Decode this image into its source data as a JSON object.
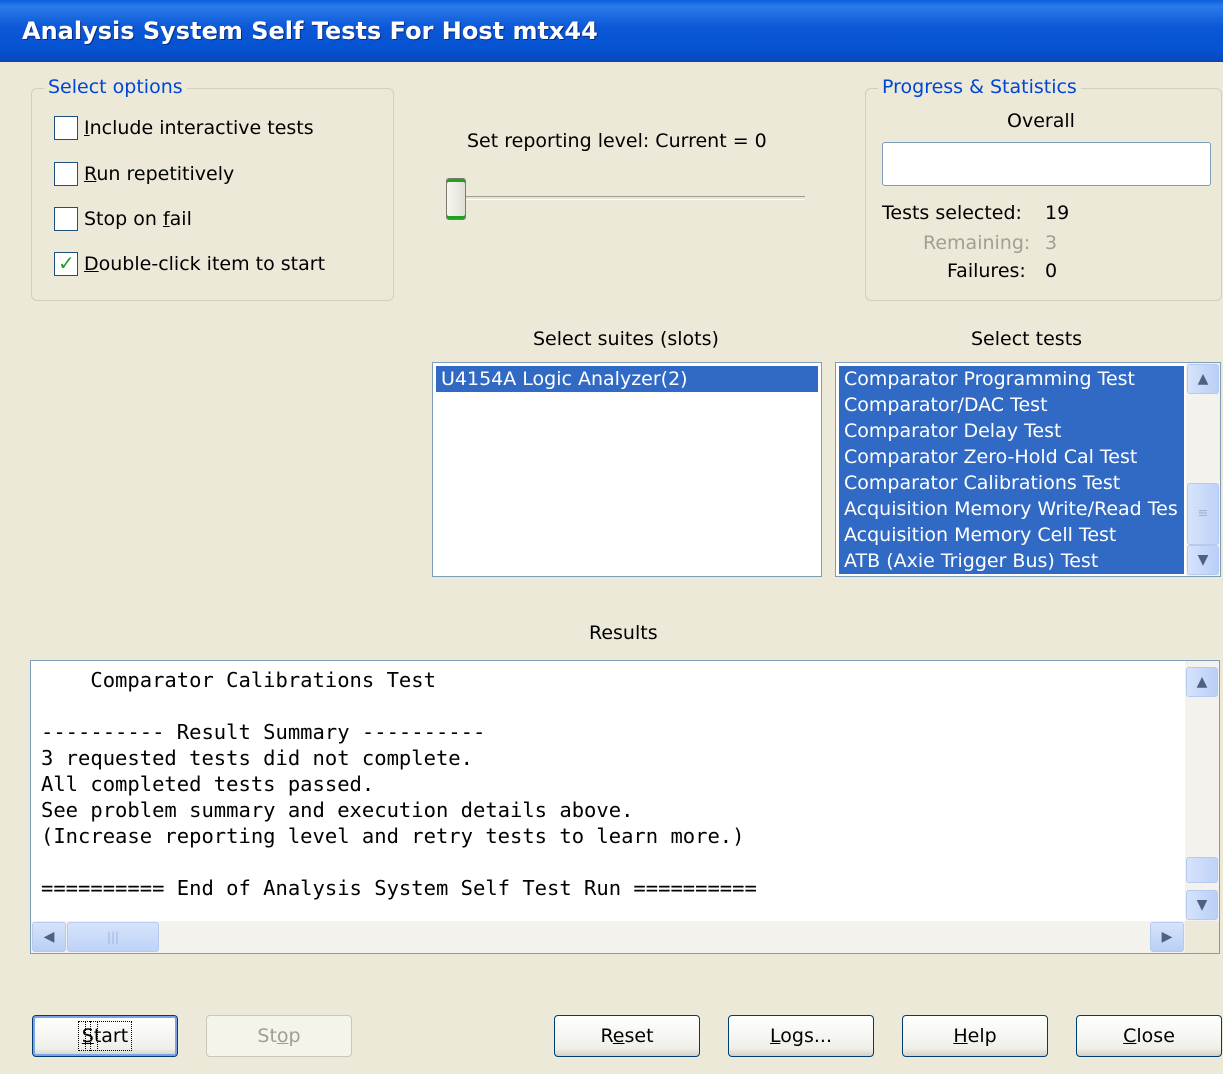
{
  "window": {
    "title": "Analysis System Self Tests For Host mtx44"
  },
  "options": {
    "legend": "Select options",
    "checkboxes": [
      {
        "label": "Include interactive tests",
        "mnemonic_prefix": "",
        "mnemonic": "I",
        "rest": "nclude interactive tests",
        "checked": false
      },
      {
        "label": "Run repetitively",
        "mnemonic_prefix": "",
        "mnemonic": "R",
        "rest": "un repetitively",
        "checked": false
      },
      {
        "label": "Stop on fail",
        "mnemonic_prefix": "Stop on ",
        "mnemonic": "f",
        "rest": "ail",
        "checked": false
      },
      {
        "label": "Double-click item to start",
        "mnemonic_prefix": "",
        "mnemonic": "D",
        "rest": "ouble-click item to start",
        "checked": true
      }
    ]
  },
  "reporting": {
    "label": "Set reporting level: Current = 0",
    "level": 0
  },
  "progress": {
    "legend": "Progress & Statistics",
    "overall_label": "Overall",
    "overall_value": 0,
    "tests_selected_label": "Tests selected:",
    "tests_selected": "19",
    "remaining_label": "Remaining:",
    "remaining": "3",
    "failures_label": "Failures:",
    "failures": "0"
  },
  "suites": {
    "label": "Select suites (slots)",
    "items": [
      "U4154A Logic Analyzer(2)"
    ]
  },
  "tests": {
    "label": "Select tests",
    "items": [
      "Comparator Programming Test",
      "Comparator/DAC Test",
      "Comparator Delay Test",
      "Comparator Zero-Hold Cal Test",
      "Comparator Calibrations Test",
      "Acquisition Memory Write/Read Tes",
      "Acquisition Memory Cell Test",
      "ATB (Axie Trigger Bus) Test"
    ]
  },
  "results": {
    "label": "Results",
    "text": "    Comparator Calibrations Test\n\n---------- Result Summary ----------\n3 requested tests did not complete.\nAll completed tests passed.\nSee problem summary and execution details above.\n(Increase reporting level and retry tests to learn more.)\n\n========== End of Analysis System Self Test Run =========="
  },
  "buttons": {
    "start": {
      "pre": "",
      "mn": "S",
      "post": "tart"
    },
    "stop": {
      "pre": "St",
      "mn": "o",
      "post": "p"
    },
    "reset": {
      "pre": "R",
      "mn": "e",
      "post": "set"
    },
    "logs": {
      "pre": "",
      "mn": "L",
      "post": "ogs..."
    },
    "help": {
      "pre": "",
      "mn": "H",
      "post": "elp"
    },
    "close": {
      "pre": "",
      "mn": "C",
      "post": "lose"
    }
  }
}
